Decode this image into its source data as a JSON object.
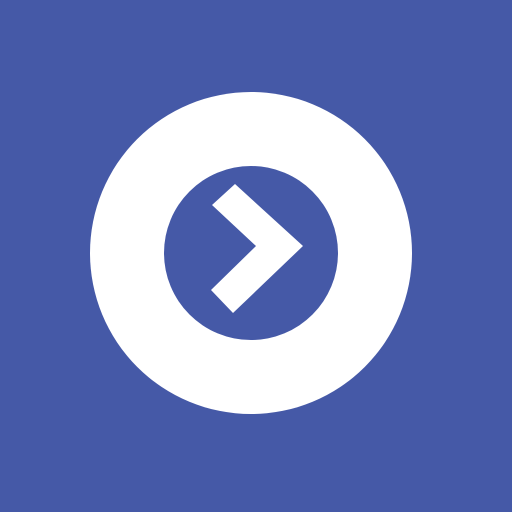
{
  "icon": {
    "name": "play-next-chevron-icon",
    "colors": {
      "background": "#4559A7",
      "ring": "#FFFFFF",
      "inner_disc": "#4559A7",
      "chevron": "#FFFFFF"
    }
  }
}
